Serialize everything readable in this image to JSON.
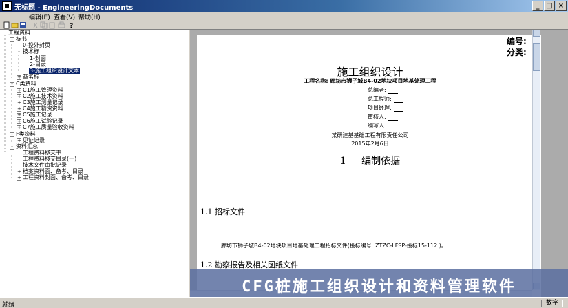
{
  "window": {
    "title": "无标题 - EngineeringDocuments"
  },
  "menu": [
    "编辑(E)",
    "查看(V)",
    "帮助(H)"
  ],
  "menu_first": "编辑(E)",
  "menu_second": "查看(V)",
  "menu_third": "帮助(H)",
  "tree": {
    "root": "工程资料",
    "n1": "标书",
    "n1a": "0-投外封页",
    "n1b": "技术标",
    "n1b1": "1-封面",
    "n1b2": "2-目录",
    "n1b3": "3-施工组织设计文本",
    "n1c": "商务标",
    "n2": "C类资料",
    "n2a": "C1施工管理资料",
    "n2b": "C2施工技术资料",
    "n2c": "C3施工测量记录",
    "n2d": "C4施工物资资料",
    "n2e": "C5施工记录",
    "n2f": "C6施工试验记录",
    "n2g": "C7施工质量验收资料",
    "n3": "F类资料",
    "n3a": "见证记录",
    "n4": "资料汇总",
    "n4a": "工程资料移交书",
    "n4b": "工程资料移交目录(一)",
    "n4c": "技术文件审批记录",
    "n4d": "档案资料面、备考、目录",
    "n4e": "工程资料封面、备考、目录"
  },
  "doc": {
    "side_label_1": "编号:",
    "side_label_2": "分类:",
    "title": "施工组织设计",
    "project": "工程名称: 廊坊市狮子城B4-02地块项目地基处理工程",
    "fields": [
      "总编者:",
      "总工程师:",
      "项目经理:",
      "审核人:",
      "编写人:"
    ],
    "company": "某研建基基础工程有限责任公司",
    "date": "2015年2月6日",
    "h1_num": "1",
    "h1": "编制依据",
    "h2_1": "1.1  招标文件",
    "body_1": "廊坊市狮子城B4-02地块项目地基处理工程招标文件(投标编号: ZTZC-LFSP-投标15-112 )。",
    "h2_2": "1.2  勘察报告及相关图纸文件"
  },
  "banner": "CFG桩施工组织设计和资料管理软件",
  "status": {
    "left": "就绪",
    "right": "数字"
  }
}
